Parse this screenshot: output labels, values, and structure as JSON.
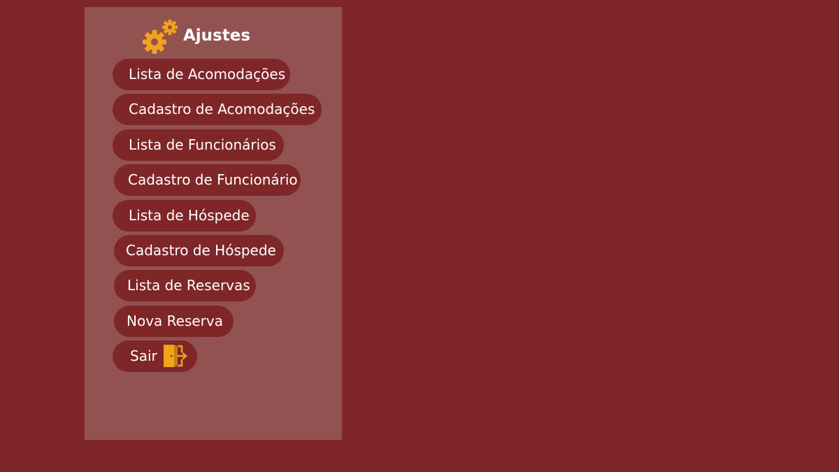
{
  "header": {
    "title": "Ajustes",
    "icon": "gears-icon"
  },
  "colors": {
    "background": "#7f2628",
    "panel": "#925251",
    "button": "#7f2628",
    "accent": "#f0a31b",
    "text": "#ffffff"
  },
  "menu": {
    "items": [
      {
        "label": "Lista de Acomodações"
      },
      {
        "label": "Cadastro de Acomodações"
      },
      {
        "label": "Lista de Funcionários"
      },
      {
        "label": "Cadastro de Funcionário"
      },
      {
        "label": "Lista de Hóspede"
      },
      {
        "label": "Cadastro de Hóspede"
      },
      {
        "label": "Lista de Reservas"
      },
      {
        "label": "Nova Reserva"
      }
    ],
    "logout": {
      "label": "Sair",
      "icon": "exit-door-icon"
    }
  }
}
